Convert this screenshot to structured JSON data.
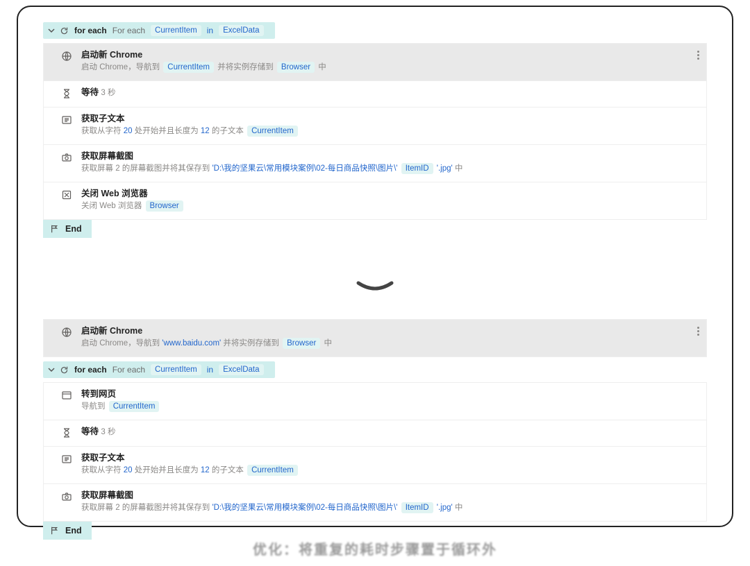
{
  "caption": "优化：将重复的耗时步骤置于循环外",
  "upper": {
    "loop": {
      "kw": "for each",
      "plain": "For each",
      "var": "CurrentItem",
      "in": "in",
      "src": "ExcelData"
    },
    "rows": [
      {
        "icon": "globe",
        "title": "启动新 Chrome",
        "pre": "启动 Chrome，导航到 ",
        "v1": "CurrentItem",
        "mid": " 并将实例存储到 ",
        "v2": "Browser",
        "post": " 中",
        "shaded": true,
        "more": true,
        "inter": true
      },
      {
        "icon": "hourglass",
        "title": "等待",
        "pre": "",
        "v1": "3 秒",
        "mid": "",
        "v2": "",
        "post": "",
        "inlineTitle": true
      },
      {
        "icon": "text",
        "title": "获取子文本",
        "pre": "获取从字符 ",
        "v1": "20",
        "mid": " 处开始并且长度为 ",
        "v2": "12",
        "post": " 的子文本 ",
        "v3": "CurrentItem"
      },
      {
        "icon": "camera",
        "title": "获取屏幕截图",
        "pre": "获取屏幕 2 的屏幕截图并将其保存到 ",
        "path": "'D:\\我的坚果云\\常用模块案例\\02-每日商品快照\\图片\\'",
        "v1": "ItemID",
        "post2": "'.jpg'",
        "tail": " 中"
      },
      {
        "icon": "close",
        "title": "关闭 Web 浏览器",
        "pre": "关闭 Web 浏览器 ",
        "v1": "Browser"
      }
    ],
    "end": "End"
  },
  "lower": {
    "launch": {
      "icon": "globe",
      "title": "启动新 Chrome",
      "pre": "启动 Chrome，导航到 ",
      "url": "'www.baidu.com'",
      "mid": " 并将实例存储到 ",
      "v2": "Browser",
      "post": " 中",
      "more": true
    },
    "loop": {
      "kw": "for each",
      "plain": "For each",
      "var": "CurrentItem",
      "in": "in",
      "src": "ExcelData"
    },
    "rows": [
      {
        "icon": "window",
        "title": "转到网页",
        "pre": "导航到 ",
        "v1": "CurrentItem"
      },
      {
        "icon": "hourglass",
        "title": "等待",
        "pre": "",
        "v1": "3 秒",
        "inlineTitle": true
      },
      {
        "icon": "text",
        "title": "获取子文本",
        "pre": "获取从字符 ",
        "v1": "20",
        "mid": " 处开始并且长度为 ",
        "v2": "12",
        "post": " 的子文本 ",
        "v3": "CurrentItem"
      },
      {
        "icon": "camera",
        "title": "获取屏幕截图",
        "pre": "获取屏幕 2 的屏幕截图并将其保存到 ",
        "path": "'D:\\我的坚果云\\常用模块案例\\02-每日商品快照\\图片\\'",
        "v1": "ItemID",
        "post2": "'.jpg'",
        "tail": " 中"
      }
    ],
    "end": "End"
  }
}
